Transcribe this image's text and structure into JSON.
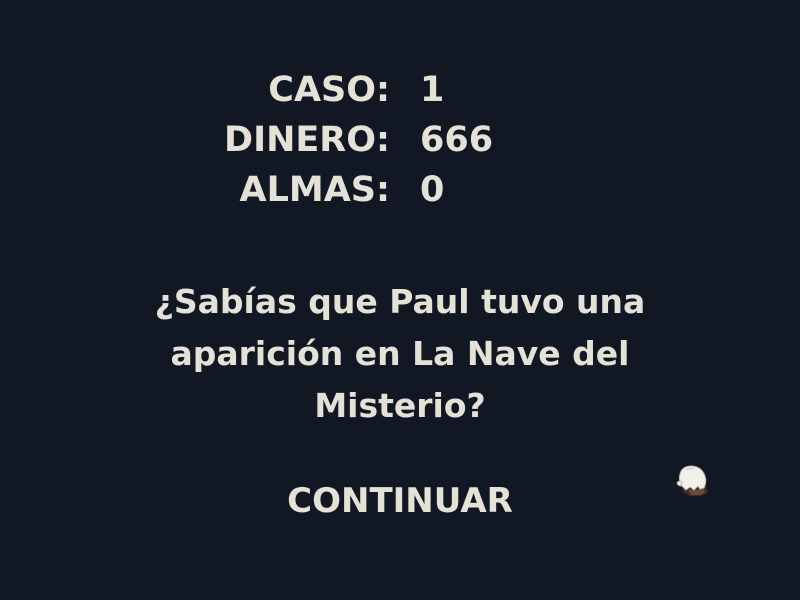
{
  "stats": [
    {
      "label": "CASO:",
      "value": "1"
    },
    {
      "label": "DINERO:",
      "value": "666"
    },
    {
      "label": "ALMAS:",
      "value": "0"
    }
  ],
  "tip": "¿Sabías que Paul tuvo una aparición en La Nave del Misterio?",
  "continue_label": "CONTINUAR",
  "cursor_icon": "ghost-icon",
  "colors": {
    "background": "#111823",
    "text": "#e4e1d6"
  }
}
